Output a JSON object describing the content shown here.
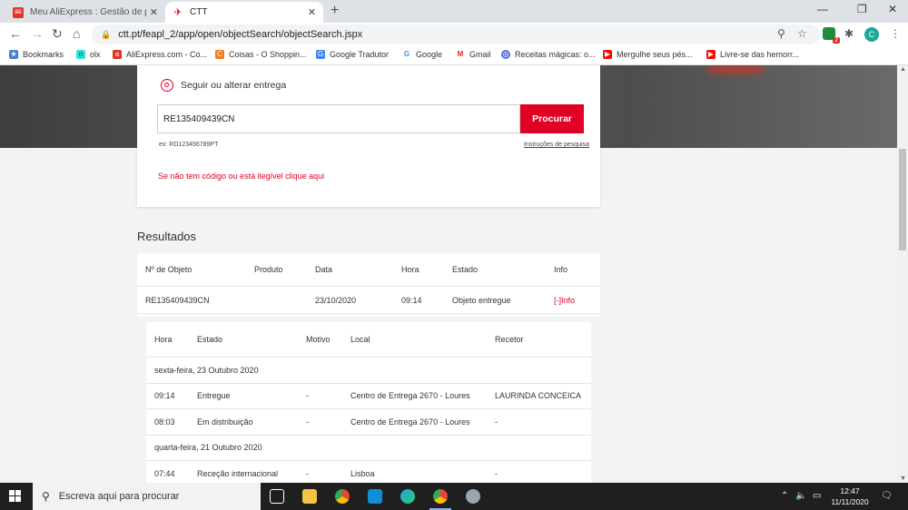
{
  "browser": {
    "tabs": [
      {
        "title": "Meu AliExpress : Gestão de pedi",
        "active": false
      },
      {
        "title": "CTT",
        "active": true
      }
    ],
    "url": "ctt.pt/feapl_2/app/open/objectSearch/objectSearch.jspx",
    "bookmarks": [
      "Bookmarks",
      "olx",
      "AliExpress.com - Co...",
      "Coisas - O Shoppin...",
      "Google Tradutor",
      "Google",
      "Gmail",
      "Receitas mágicas: o...",
      "Mergulhe seus pés...",
      "Livre-se das hemorr..."
    ],
    "extension_badge": "2",
    "profile_initial": "C"
  },
  "search": {
    "heading": "Seguir ou alterar entrega",
    "input_value": "RE135409439CN",
    "button_label": "Procurar",
    "example": "ex: RD123456789PT",
    "instructions_link": "Instruções de pesquisa",
    "no_code_link": "Se não tem código ou está ilegível clique aqui"
  },
  "results": {
    "title": "Resultados",
    "headers": [
      "Nº de Objeto",
      "Produto",
      "Data",
      "Hora",
      "Estado",
      "Info"
    ],
    "row": {
      "objeto": "RE135409439CN",
      "produto": "",
      "data": "23/10/2020",
      "hora": "09:14",
      "estado": "Objeto entregue",
      "info": "[-]Info"
    }
  },
  "details": {
    "headers": [
      "Hora",
      "Estado",
      "Motivo",
      "Local",
      "Recetor"
    ],
    "groups": [
      {
        "date": "sexta-feira, 23 Outubro 2020"
      },
      {
        "hora": "09:14",
        "estado": "Entregue",
        "motivo": "-",
        "local": "Centro de Entrega 2670 - Loures",
        "recetor": "LAURINDA CONCEICA"
      },
      {
        "hora": "08:03",
        "estado": "Em distribuição",
        "motivo": "-",
        "local": "Centro de Entrega 2670 - Loures",
        "recetor": "-"
      },
      {
        "date": "quarta-feira, 21 Outubro 2020"
      },
      {
        "hora": "07:44",
        "estado": "Receção internacional",
        "motivo": "-",
        "local": "Lisboa",
        "recetor": "-"
      }
    ]
  },
  "taskbar": {
    "search_placeholder": "Escreva aqui para procurar",
    "time": "12:47",
    "date": "11/11/2020"
  },
  "colors": {
    "accent": "#df0024"
  }
}
